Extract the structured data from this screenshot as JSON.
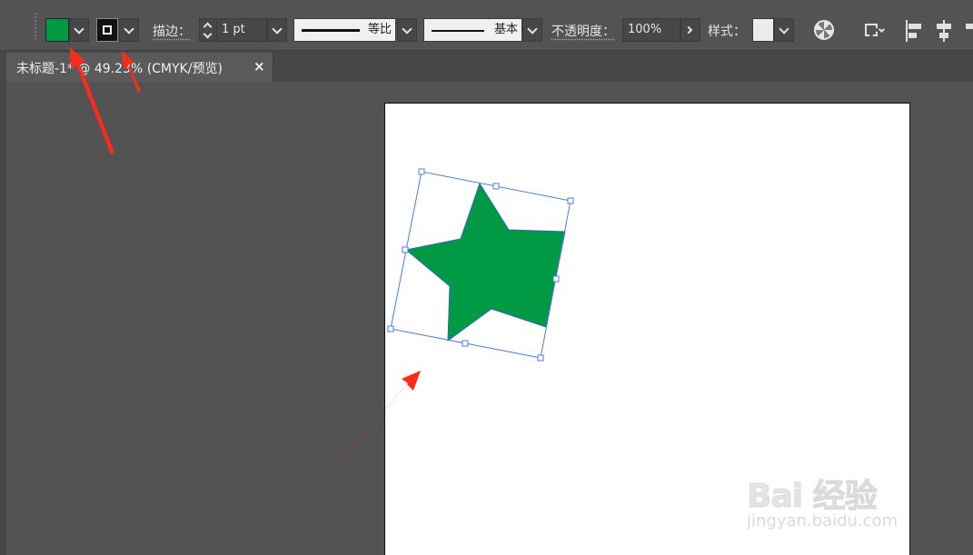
{
  "control_bar": {
    "fill_color": "#009a44",
    "stroke_label": "描边：",
    "stroke_weight": "1 pt",
    "profile_label": "等比",
    "brush_label": "基本",
    "opacity_label": "不透明度：",
    "opacity_value": "100%",
    "style_label": "样式："
  },
  "document_tab": {
    "title": "未标题-1* @ 49.23% (CMYK/预览)",
    "close": "×"
  },
  "artwork": {
    "star_fill": "#009a44",
    "selection_color": "#4a7fe0"
  },
  "watermark": {
    "brand": "Bai 经验",
    "url": "jingyan.baidu.com"
  }
}
